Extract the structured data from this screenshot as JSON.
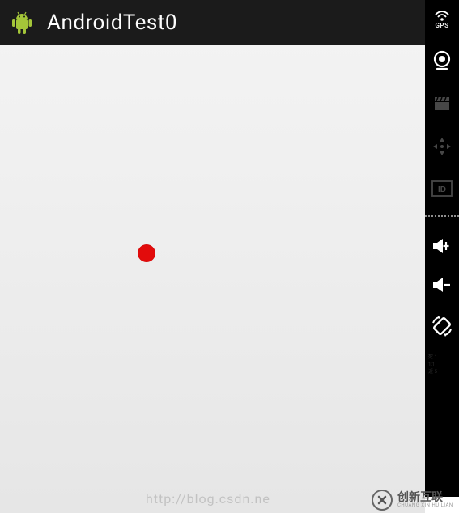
{
  "header": {
    "title": "AndroidTest0",
    "icon_name": "android-icon"
  },
  "canvas": {
    "dot_color": "#e20b0b"
  },
  "sidebar": {
    "gps_label": "GPS",
    "id_label": "ID",
    "stats_text": "死 1\n1:1\n近 5"
  },
  "watermark": {
    "text": "http://blog.csdn.ne"
  },
  "corner_logo": {
    "main": "创新互联",
    "sub": "CHUANG XIN HU LIAN"
  }
}
